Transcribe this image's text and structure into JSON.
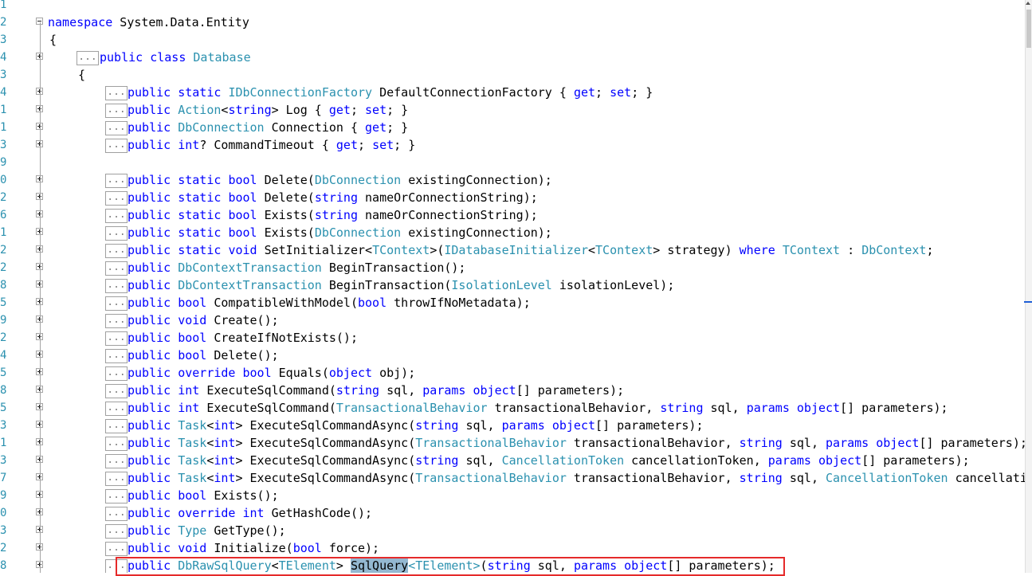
{
  "lines": [
    {
      "ln": "1",
      "fold": "",
      "box": "",
      "indent": 0,
      "tokens": []
    },
    {
      "ln": "2",
      "fold": "minus",
      "box": "",
      "indent": 1,
      "tokens": [
        [
          "k",
          "namespace"
        ],
        [
          "p",
          " System.Data.Entity"
        ]
      ]
    },
    {
      "ln": "3",
      "fold": "",
      "box": "",
      "indent": 1,
      "tokens": [
        [
          "p",
          "{"
        ]
      ]
    },
    {
      "ln": "4",
      "fold": "plus",
      "box": "...",
      "indent": 2,
      "tokens": [
        [
          "k",
          "public"
        ],
        [
          "p",
          " "
        ],
        [
          "k",
          "class"
        ],
        [
          "p",
          " "
        ],
        [
          "t",
          "Database"
        ]
      ]
    },
    {
      "ln": "3",
      "fold": "",
      "box": "",
      "indent": 2,
      "tokens": [
        [
          "p",
          "{"
        ]
      ]
    },
    {
      "ln": "4",
      "fold": "plus",
      "box": "...",
      "indent": 3,
      "tokens": [
        [
          "k",
          "public"
        ],
        [
          "p",
          " "
        ],
        [
          "k",
          "static"
        ],
        [
          "p",
          " "
        ],
        [
          "t",
          "IDbConnectionFactory"
        ],
        [
          "p",
          " DefaultConnectionFactory { "
        ],
        [
          "k",
          "get"
        ],
        [
          "p",
          "; "
        ],
        [
          "k",
          "set"
        ],
        [
          "p",
          "; }"
        ]
      ]
    },
    {
      "ln": "1",
      "fold": "plus",
      "box": "...",
      "indent": 3,
      "tokens": [
        [
          "k",
          "public"
        ],
        [
          "p",
          " "
        ],
        [
          "t",
          "Action"
        ],
        [
          "p",
          "<"
        ],
        [
          "k",
          "string"
        ],
        [
          "p",
          "> Log { "
        ],
        [
          "k",
          "get"
        ],
        [
          "p",
          "; "
        ],
        [
          "k",
          "set"
        ],
        [
          "p",
          "; }"
        ]
      ]
    },
    {
      "ln": "1",
      "fold": "plus",
      "box": "...",
      "indent": 3,
      "tokens": [
        [
          "k",
          "public"
        ],
        [
          "p",
          " "
        ],
        [
          "t",
          "DbConnection"
        ],
        [
          "p",
          " Connection { "
        ],
        [
          "k",
          "get"
        ],
        [
          "p",
          "; }"
        ]
      ]
    },
    {
      "ln": "3",
      "fold": "plus",
      "box": "...",
      "indent": 3,
      "tokens": [
        [
          "k",
          "public"
        ],
        [
          "p",
          " "
        ],
        [
          "k",
          "int"
        ],
        [
          "p",
          "? CommandTimeout { "
        ],
        [
          "k",
          "get"
        ],
        [
          "p",
          "; "
        ],
        [
          "k",
          "set"
        ],
        [
          "p",
          "; }"
        ]
      ]
    },
    {
      "ln": "9",
      "fold": "",
      "box": "",
      "indent": 3,
      "tokens": []
    },
    {
      "ln": "0",
      "fold": "plus",
      "box": "...",
      "indent": 3,
      "tokens": [
        [
          "k",
          "public"
        ],
        [
          "p",
          " "
        ],
        [
          "k",
          "static"
        ],
        [
          "p",
          " "
        ],
        [
          "k",
          "bool"
        ],
        [
          "p",
          " Delete("
        ],
        [
          "t",
          "DbConnection"
        ],
        [
          "p",
          " existingConnection);"
        ]
      ]
    },
    {
      "ln": "2",
      "fold": "plus",
      "box": "...",
      "indent": 3,
      "tokens": [
        [
          "k",
          "public"
        ],
        [
          "p",
          " "
        ],
        [
          "k",
          "static"
        ],
        [
          "p",
          " "
        ],
        [
          "k",
          "bool"
        ],
        [
          "p",
          " Delete("
        ],
        [
          "k",
          "string"
        ],
        [
          "p",
          " nameOrConnectionString);"
        ]
      ]
    },
    {
      "ln": "6",
      "fold": "plus",
      "box": "...",
      "indent": 3,
      "tokens": [
        [
          "k",
          "public"
        ],
        [
          "p",
          " "
        ],
        [
          "k",
          "static"
        ],
        [
          "p",
          " "
        ],
        [
          "k",
          "bool"
        ],
        [
          "p",
          " Exists("
        ],
        [
          "k",
          "string"
        ],
        [
          "p",
          " nameOrConnectionString);"
        ]
      ]
    },
    {
      "ln": "1",
      "fold": "plus",
      "box": "...",
      "indent": 3,
      "tokens": [
        [
          "k",
          "public"
        ],
        [
          "p",
          " "
        ],
        [
          "k",
          "static"
        ],
        [
          "p",
          " "
        ],
        [
          "k",
          "bool"
        ],
        [
          "p",
          " Exists("
        ],
        [
          "t",
          "DbConnection"
        ],
        [
          "p",
          " existingConnection);"
        ]
      ]
    },
    {
      "ln": "2",
      "fold": "plus",
      "box": "...",
      "indent": 3,
      "tokens": [
        [
          "k",
          "public"
        ],
        [
          "p",
          " "
        ],
        [
          "k",
          "static"
        ],
        [
          "p",
          " "
        ],
        [
          "k",
          "void"
        ],
        [
          "p",
          " SetInitializer<"
        ],
        [
          "t",
          "TContext"
        ],
        [
          "p",
          ">("
        ],
        [
          "t",
          "IDatabaseInitializer"
        ],
        [
          "p",
          "<"
        ],
        [
          "t",
          "TContext"
        ],
        [
          "p",
          "> strategy) "
        ],
        [
          "k",
          "where"
        ],
        [
          "p",
          " "
        ],
        [
          "t",
          "TContext"
        ],
        [
          "p",
          " : "
        ],
        [
          "t",
          "DbContext"
        ],
        [
          "p",
          ";"
        ]
      ]
    },
    {
      "ln": "2",
      "fold": "plus",
      "box": "...",
      "indent": 3,
      "tokens": [
        [
          "k",
          "public"
        ],
        [
          "p",
          " "
        ],
        [
          "t",
          "DbContextTransaction"
        ],
        [
          "p",
          " BeginTransaction();"
        ]
      ]
    },
    {
      "ln": "8",
      "fold": "plus",
      "box": "...",
      "indent": 3,
      "tokens": [
        [
          "k",
          "public"
        ],
        [
          "p",
          " "
        ],
        [
          "t",
          "DbContextTransaction"
        ],
        [
          "p",
          " BeginTransaction("
        ],
        [
          "t",
          "IsolationLevel"
        ],
        [
          "p",
          " isolationLevel);"
        ]
      ]
    },
    {
      "ln": "5",
      "fold": "plus",
      "box": "...",
      "indent": 3,
      "tokens": [
        [
          "k",
          "public"
        ],
        [
          "p",
          " "
        ],
        [
          "k",
          "bool"
        ],
        [
          "p",
          " CompatibleWithModel("
        ],
        [
          "k",
          "bool"
        ],
        [
          "p",
          " throwIfNoMetadata);"
        ]
      ]
    },
    {
      "ln": "9",
      "fold": "plus",
      "box": "...",
      "indent": 3,
      "tokens": [
        [
          "k",
          "public"
        ],
        [
          "p",
          " "
        ],
        [
          "k",
          "void"
        ],
        [
          "p",
          " Create();"
        ]
      ]
    },
    {
      "ln": "2",
      "fold": "plus",
      "box": "...",
      "indent": 3,
      "tokens": [
        [
          "k",
          "public"
        ],
        [
          "p",
          " "
        ],
        [
          "k",
          "bool"
        ],
        [
          "p",
          " CreateIfNotExists();"
        ]
      ]
    },
    {
      "ln": "4",
      "fold": "plus",
      "box": "...",
      "indent": 3,
      "tokens": [
        [
          "k",
          "public"
        ],
        [
          "p",
          " "
        ],
        [
          "k",
          "bool"
        ],
        [
          "p",
          " Delete();"
        ]
      ]
    },
    {
      "ln": "5",
      "fold": "plus",
      "box": "...",
      "indent": 3,
      "tokens": [
        [
          "k",
          "public"
        ],
        [
          "p",
          " "
        ],
        [
          "k",
          "override"
        ],
        [
          "p",
          " "
        ],
        [
          "k",
          "bool"
        ],
        [
          "p",
          " Equals("
        ],
        [
          "k",
          "object"
        ],
        [
          "p",
          " obj);"
        ]
      ]
    },
    {
      "ln": "8",
      "fold": "plus",
      "box": "...",
      "indent": 3,
      "tokens": [
        [
          "k",
          "public"
        ],
        [
          "p",
          " "
        ],
        [
          "k",
          "int"
        ],
        [
          "p",
          " ExecuteSqlCommand("
        ],
        [
          "k",
          "string"
        ],
        [
          "p",
          " sql, "
        ],
        [
          "k",
          "params"
        ],
        [
          "p",
          " "
        ],
        [
          "k",
          "object"
        ],
        [
          "p",
          "[] parameters);"
        ]
      ]
    },
    {
      "ln": "5",
      "fold": "plus",
      "box": "...",
      "indent": 3,
      "tokens": [
        [
          "k",
          "public"
        ],
        [
          "p",
          " "
        ],
        [
          "k",
          "int"
        ],
        [
          "p",
          " ExecuteSqlCommand("
        ],
        [
          "t",
          "TransactionalBehavior"
        ],
        [
          "p",
          " transactionalBehavior, "
        ],
        [
          "k",
          "string"
        ],
        [
          "p",
          " sql, "
        ],
        [
          "k",
          "params"
        ],
        [
          "p",
          " "
        ],
        [
          "k",
          "object"
        ],
        [
          "p",
          "[] parameters);"
        ]
      ]
    },
    {
      "ln": "3",
      "fold": "plus",
      "box": "...",
      "indent": 3,
      "tokens": [
        [
          "k",
          "public"
        ],
        [
          "p",
          " "
        ],
        [
          "t",
          "Task"
        ],
        [
          "p",
          "<"
        ],
        [
          "k",
          "int"
        ],
        [
          "p",
          "> ExecuteSqlCommandAsync("
        ],
        [
          "k",
          "string"
        ],
        [
          "p",
          " sql, "
        ],
        [
          "k",
          "params"
        ],
        [
          "p",
          " "
        ],
        [
          "k",
          "object"
        ],
        [
          "p",
          "[] parameters);"
        ]
      ]
    },
    {
      "ln": "1",
      "fold": "plus",
      "box": "...",
      "indent": 3,
      "tokens": [
        [
          "k",
          "public"
        ],
        [
          "p",
          " "
        ],
        [
          "t",
          "Task"
        ],
        [
          "p",
          "<"
        ],
        [
          "k",
          "int"
        ],
        [
          "p",
          "> ExecuteSqlCommandAsync("
        ],
        [
          "t",
          "TransactionalBehavior"
        ],
        [
          "p",
          " transactionalBehavior, "
        ],
        [
          "k",
          "string"
        ],
        [
          "p",
          " sql, "
        ],
        [
          "k",
          "params"
        ],
        [
          "p",
          " "
        ],
        [
          "k",
          "object"
        ],
        [
          "p",
          "[] parameters);"
        ]
      ]
    },
    {
      "ln": "3",
      "fold": "plus",
      "box": "...",
      "indent": 3,
      "tokens": [
        [
          "k",
          "public"
        ],
        [
          "p",
          " "
        ],
        [
          "t",
          "Task"
        ],
        [
          "p",
          "<"
        ],
        [
          "k",
          "int"
        ],
        [
          "p",
          "> ExecuteSqlCommandAsync("
        ],
        [
          "k",
          "string"
        ],
        [
          "p",
          " sql, "
        ],
        [
          "t",
          "CancellationToken"
        ],
        [
          "p",
          " cancellationToken, "
        ],
        [
          "k",
          "params"
        ],
        [
          "p",
          " "
        ],
        [
          "k",
          "object"
        ],
        [
          "p",
          "[] parameters);"
        ]
      ]
    },
    {
      "ln": "7",
      "fold": "plus",
      "box": "...",
      "indent": 3,
      "tokens": [
        [
          "k",
          "public"
        ],
        [
          "p",
          " "
        ],
        [
          "t",
          "Task"
        ],
        [
          "p",
          "<"
        ],
        [
          "k",
          "int"
        ],
        [
          "p",
          "> ExecuteSqlCommandAsync("
        ],
        [
          "t",
          "TransactionalBehavior"
        ],
        [
          "p",
          " transactionalBehavior, "
        ],
        [
          "k",
          "string"
        ],
        [
          "p",
          " sql, "
        ],
        [
          "t",
          "CancellationToken"
        ],
        [
          "p",
          " cancellatic"
        ]
      ]
    },
    {
      "ln": "9",
      "fold": "plus",
      "box": "...",
      "indent": 3,
      "tokens": [
        [
          "k",
          "public"
        ],
        [
          "p",
          " "
        ],
        [
          "k",
          "bool"
        ],
        [
          "p",
          " Exists();"
        ]
      ]
    },
    {
      "ln": "0",
      "fold": "plus",
      "box": "...",
      "indent": 3,
      "tokens": [
        [
          "k",
          "public"
        ],
        [
          "p",
          " "
        ],
        [
          "k",
          "override"
        ],
        [
          "p",
          " "
        ],
        [
          "k",
          "int"
        ],
        [
          "p",
          " GetHashCode();"
        ]
      ]
    },
    {
      "ln": "3",
      "fold": "plus",
      "box": "...",
      "indent": 3,
      "tokens": [
        [
          "k",
          "public"
        ],
        [
          "p",
          " "
        ],
        [
          "t",
          "Type"
        ],
        [
          "p",
          " GetType();"
        ]
      ]
    },
    {
      "ln": "2",
      "fold": "plus",
      "box": "...",
      "indent": 3,
      "tokens": [
        [
          "k",
          "public"
        ],
        [
          "p",
          " "
        ],
        [
          "k",
          "void"
        ],
        [
          "p",
          " Initialize("
        ],
        [
          "k",
          "bool"
        ],
        [
          "p",
          " force);"
        ]
      ]
    },
    {
      "ln": "8",
      "fold": "plus",
      "box": "...",
      "indent": 3,
      "tokens": [
        [
          "k",
          "public"
        ],
        [
          "p",
          " "
        ],
        [
          "t",
          "DbRawSqlQuery"
        ],
        [
          "p",
          "<"
        ],
        [
          "t",
          "TElement"
        ],
        [
          "p",
          "> "
        ],
        [
          "h",
          "SqlQuery"
        ],
        [
          "t",
          "<TElement>"
        ],
        [
          "p",
          "("
        ],
        [
          "k",
          "string"
        ],
        [
          "p",
          " sql, "
        ],
        [
          "k",
          "params"
        ],
        [
          "p",
          " "
        ],
        [
          "k",
          "object"
        ],
        [
          "p",
          "[] parameters);"
        ]
      ]
    }
  ],
  "colors": {
    "keyword": "#0000ff",
    "type": "#2b91af",
    "line_number": "#2b91af",
    "highlight": "#94b8d1",
    "red_box": "#e52a2a"
  },
  "annotation": {
    "highlighted_line_index": 32,
    "label": "SqlQuery"
  }
}
